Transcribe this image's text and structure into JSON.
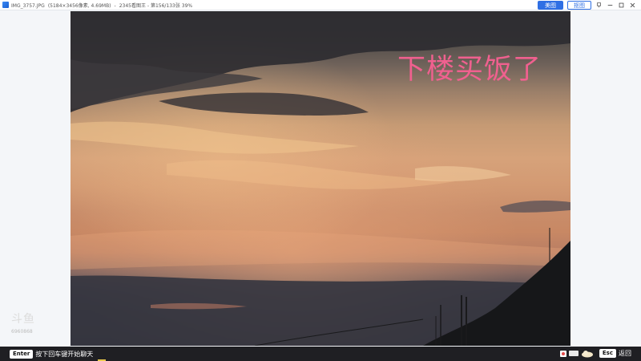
{
  "titlebar": {
    "filename": "IMG_3757.JPG",
    "dimensions": "(5184×3456像素, 4.69MB)",
    "separator": "-",
    "info": "2345看图王 - 第156/133张 39%",
    "btn_meitu": "美图",
    "btn_koutu": "抠图",
    "icons": [
      "pin-icon",
      "minimize-icon",
      "maximize-icon",
      "close-icon"
    ]
  },
  "photo": {
    "overlay_text": "下楼买饭了"
  },
  "watermark": {
    "line1": "斗鱼",
    "line2": "6960868"
  },
  "bottombar": {
    "enter_key": "Enter",
    "enter_hint": "按下回车键开始聊天",
    "esc_key": "Esc",
    "esc_hint": "返回"
  },
  "colors": {
    "accent": "#2f6fe4",
    "overlay_text": "#f0608f",
    "bottombar_bg": "#1f1f23"
  }
}
